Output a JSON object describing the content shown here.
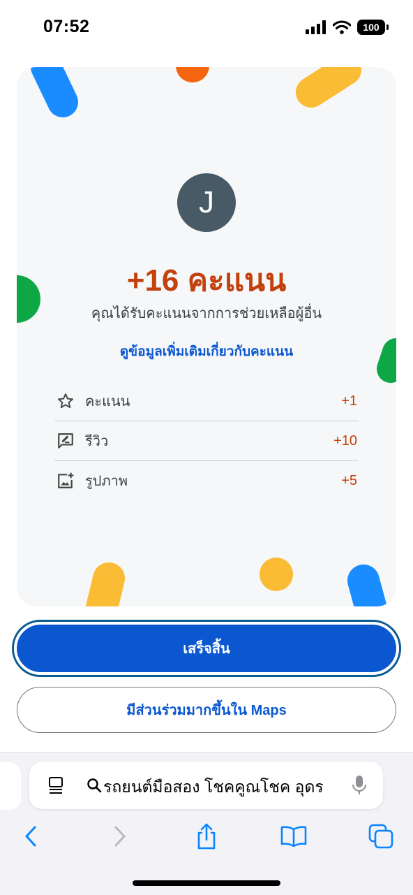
{
  "status_bar": {
    "time": "07:52",
    "battery": "100"
  },
  "card": {
    "avatar_letter": "J",
    "points_title": "+16 คะแนน",
    "points_subtitle": "คุณได้รับคะแนนจากการช่วยเหลือผู้อื่น",
    "learn_more": "ดูข้อมูลเพิ่มเติมเกี่ยวกับคะแนน",
    "items": [
      {
        "label": "คะแนน",
        "value": "+1",
        "icon": "star-outline-icon"
      },
      {
        "label": "รีวิว",
        "value": "+10",
        "icon": "review-icon"
      },
      {
        "label": "รูปภาพ",
        "value": "+5",
        "icon": "add-photo-icon"
      }
    ]
  },
  "buttons": {
    "done": "เสร็จสิ้น",
    "contribute": "มีส่วนร่วมมากขึ้นใน Maps"
  },
  "browser": {
    "address_text": "รถยนต์มือสอง โชคคูณโชค อุดร"
  },
  "colors": {
    "accent": "#0b57d0",
    "points": "#c2410c",
    "card_bg": "#f6f7f9",
    "avatar": "#485a65"
  }
}
